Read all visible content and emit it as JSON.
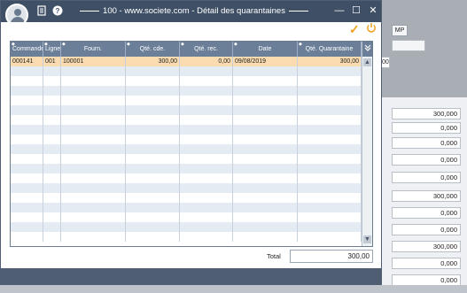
{
  "window": {
    "title": "100 - www.societe.com - Détail des quarantaines",
    "minimize_glyph": "—",
    "maximize_glyph": "☐",
    "close_glyph": "✕"
  },
  "toolbar": {
    "doc_icon": "document-icon",
    "help_icon": "help-icon",
    "validate_glyph": "✓",
    "power_icon": "power-icon"
  },
  "grid": {
    "columns": [
      "Commande",
      "Ligne",
      "Fourn.",
      "Qté. cde.",
      "Qté. rec.",
      "Date",
      "Qté. Quarantaine"
    ],
    "rows": [
      [
        "000141",
        "001",
        "100001",
        "300,00",
        "0,00",
        "09/08/2019",
        "300,00"
      ]
    ]
  },
  "total": {
    "label": "Total",
    "value": "300,00"
  },
  "background_app": {
    "mp_label": "MP",
    "field_glyph": "00",
    "values": [
      "300,000",
      "0,000",
      "0,000",
      "0,000",
      "0,000",
      "300,000",
      "0,000",
      "0,000",
      "300,000",
      "0,000",
      "0,000"
    ]
  },
  "colors": {
    "titlebar": "#3f4f66",
    "grid_header": "#6b7f98",
    "selected_row": "#fbdcb1",
    "accent": "#f0a020"
  }
}
